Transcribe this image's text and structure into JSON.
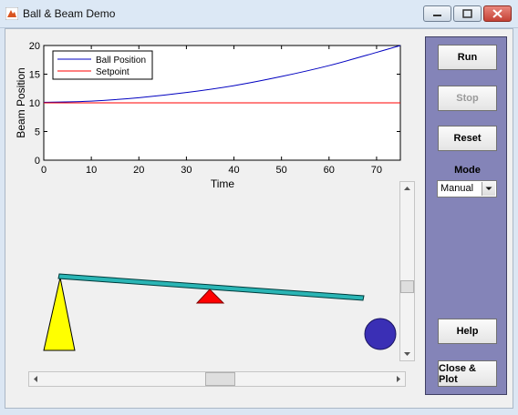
{
  "window": {
    "title": "Ball & Beam Demo"
  },
  "plot": {
    "xlabel": "Time",
    "ylabel": "Beam Position",
    "legend": [
      "Ball Position",
      "Setpoint"
    ]
  },
  "controls": {
    "run": "Run",
    "stop": "Stop",
    "reset": "Reset",
    "mode_label": "Mode",
    "mode_value": "Manual",
    "help": "Help",
    "close_plot": "Close & Plot"
  },
  "chart_data": {
    "type": "line",
    "xlabel": "Time",
    "ylabel": "Beam Position",
    "xlim": [
      0,
      75
    ],
    "ylim": [
      0,
      20
    ],
    "x_ticks": [
      0,
      10,
      20,
      30,
      40,
      50,
      60,
      70
    ],
    "y_ticks": [
      0,
      5,
      10,
      15,
      20
    ],
    "legend_position": "top-left",
    "grid": false,
    "series": [
      {
        "name": "Ball Position",
        "color": "#0000c0",
        "x": [
          0,
          10,
          20,
          30,
          40,
          50,
          60,
          70,
          75
        ],
        "y": [
          10.1,
          10.3,
          10.9,
          11.8,
          13.0,
          14.6,
          16.5,
          18.8,
          20.0
        ]
      },
      {
        "name": "Setpoint",
        "color": "#ff0000",
        "x": [
          0,
          75
        ],
        "y": [
          10,
          10
        ]
      }
    ]
  },
  "colors": {
    "panel": "#8484b8",
    "beam": "#2ab5b5",
    "pivot": "#ff0000",
    "support": "#ffff00",
    "ball": "#3a2fb5"
  }
}
